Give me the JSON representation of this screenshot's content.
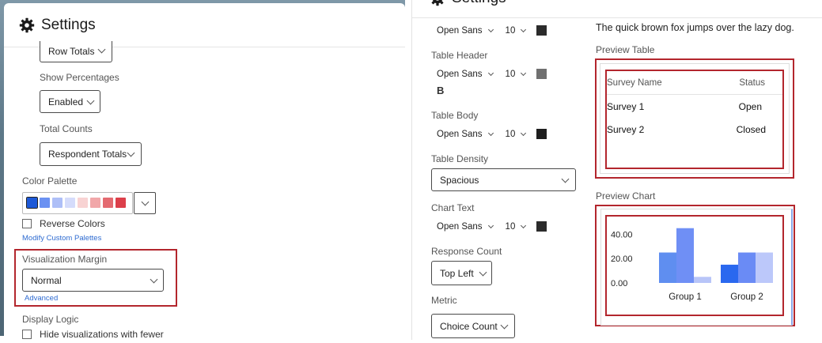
{
  "settings_title": "Settings",
  "left": {
    "row_totals": "Row Totals",
    "show_percentages_label": "Show Percentages",
    "show_percentages_value": "Enabled",
    "total_counts_label": "Total Counts",
    "total_counts_value": "Respondent Totals",
    "color_palette_label": "Color Palette",
    "palette_colors": [
      "#1d59d7",
      "#6b91f2",
      "#aebff7",
      "#d5dcfb",
      "#f8d3d3",
      "#f1a7a9",
      "#e46a70",
      "#dc3f4a"
    ],
    "reverse_colors": "Reverse Colors",
    "modify_palettes": "Modify Custom Palettes",
    "viz_margin_label": "Visualization Margin",
    "viz_margin_value": "Normal",
    "advanced": "Advanced",
    "display_logic_label": "Display Logic",
    "hide_text": "Hide visualizations with fewer"
  },
  "right": {
    "title_font": {
      "font": "Open Sans",
      "size": "10",
      "color": "#2b2b2b"
    },
    "table_header_label": "Table Header",
    "table_header_font": {
      "font": "Open Sans",
      "size": "10",
      "color": "#707070"
    },
    "bold_glyph": "B",
    "table_body_label": "Table Body",
    "table_body_font": {
      "font": "Open Sans",
      "size": "10",
      "color": "#1e1e1e"
    },
    "table_density_label": "Table Density",
    "table_density_value": "Spacious",
    "chart_text_label": "Chart Text",
    "chart_text_font": {
      "font": "Open Sans",
      "size": "10",
      "color": "#2b2b2b"
    },
    "response_count_label": "Response Count",
    "response_count_value": "Top Left",
    "metric_label": "Metric",
    "metric_value": "Choice Count",
    "sample_text": "The quick brown fox jumps over the lazy dog.",
    "preview_table_label": "Preview Table",
    "preview_table": {
      "headers": [
        "Survey Name",
        "Status"
      ],
      "rows": [
        [
          "Survey 1",
          "Open"
        ],
        [
          "Survey 2",
          "Closed"
        ]
      ]
    },
    "preview_chart_label": "Preview Chart"
  },
  "chart_data": {
    "type": "bar",
    "categories": [
      "Group 1",
      "Group 2"
    ],
    "series": [
      {
        "values": [
          25,
          15
        ],
        "color": "#5f8ef0"
      },
      {
        "values": [
          45,
          25
        ],
        "color": "#6f8ff5"
      },
      {
        "values": [
          5,
          25
        ],
        "color": "#b8c5f8"
      }
    ],
    "ylim": [
      0,
      50
    ],
    "yticks": [
      "40.00",
      "20.00",
      "0.00"
    ],
    "grid": false
  }
}
